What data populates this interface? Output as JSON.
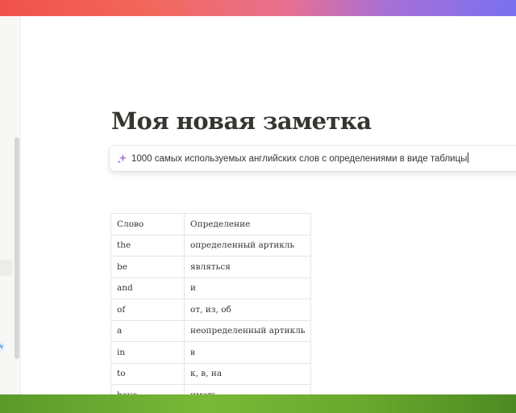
{
  "page": {
    "title": "Моя новая заметка"
  },
  "ai_prompt": {
    "icon": "sparkle-icon",
    "text": "1000 самых используемых английских слов с определениями в виде таблицы"
  },
  "sidebar": {
    "badge_text": "w"
  },
  "table": {
    "headers": [
      "Слово",
      "Определение"
    ],
    "rows": [
      [
        "the",
        "определенный артикль"
      ],
      [
        "be",
        "являться"
      ],
      [
        "and",
        "и"
      ],
      [
        "of",
        "от, из, об"
      ],
      [
        "a",
        "неопределенный артикль"
      ],
      [
        "in",
        "в"
      ],
      [
        "to",
        "к, в, на"
      ],
      [
        "have",
        "иметь"
      ]
    ]
  },
  "colors": {
    "text": "#37352f",
    "accent": "#2383e2",
    "sparkle": "#a77bd8"
  }
}
